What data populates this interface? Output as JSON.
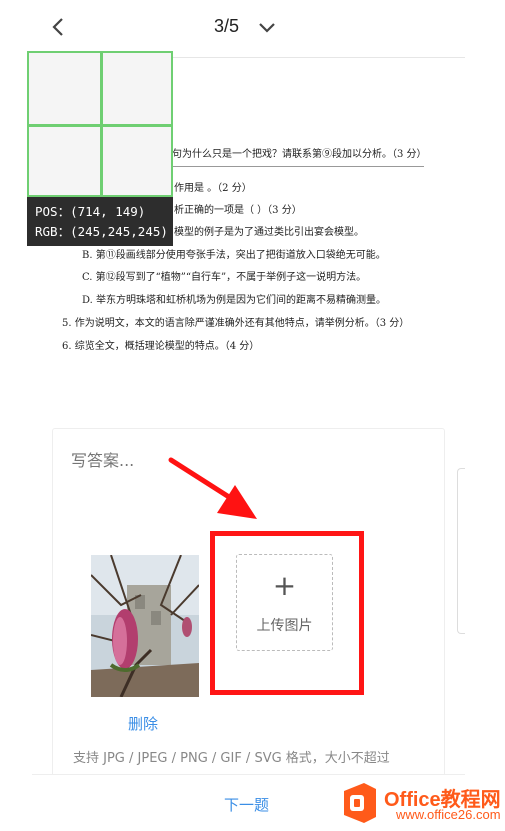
{
  "header": {
    "page_indicator": "3/5"
  },
  "question": {
    "lines": [
      "句为什么只是一个把戏？请联系第⑨段加以分析。（3 分）",
      "作用是 。（2 分）",
      "析正确的一项是（ ）（3 分）",
      "模型的例子是为了通过类比引出宴会模型。",
      "B. 第⑪段画线部分使用夸张手法，突出了把街道放入口袋绝无可能。",
      "C. 第⑫段写到了“植物”“自行车”，不属于举例子这一说明方法。",
      "D. 举东方明珠塔和虹桥机场为例是因为它们间的距离不易精确测量。",
      "5. 作为说明文，本文的语言除严谨准确外还有其他特点，请举例分析。（3 分）",
      "6. 综览全文，概括理论模型的特点。（4 分）"
    ]
  },
  "inspector": {
    "pos": "POS：(714, 149)",
    "rgb": "RGB：(245,245,245)"
  },
  "answer": {
    "placeholder": "写答案...",
    "upload_label": "上传图片",
    "upload_plus": "+",
    "delete_label": "删除",
    "hint": "支持 JPG / JPEG / PNG / GIF / SVG 格式，大小不超过"
  },
  "footer": {
    "next_label": "下一题"
  },
  "watermark": {
    "brand": "Office教程网",
    "url": "www.office26.com"
  },
  "colors": {
    "highlight": "#ff1515",
    "link": "#3a8ee6",
    "grid": "#6fcf72",
    "brand": "#ff5a1a"
  }
}
